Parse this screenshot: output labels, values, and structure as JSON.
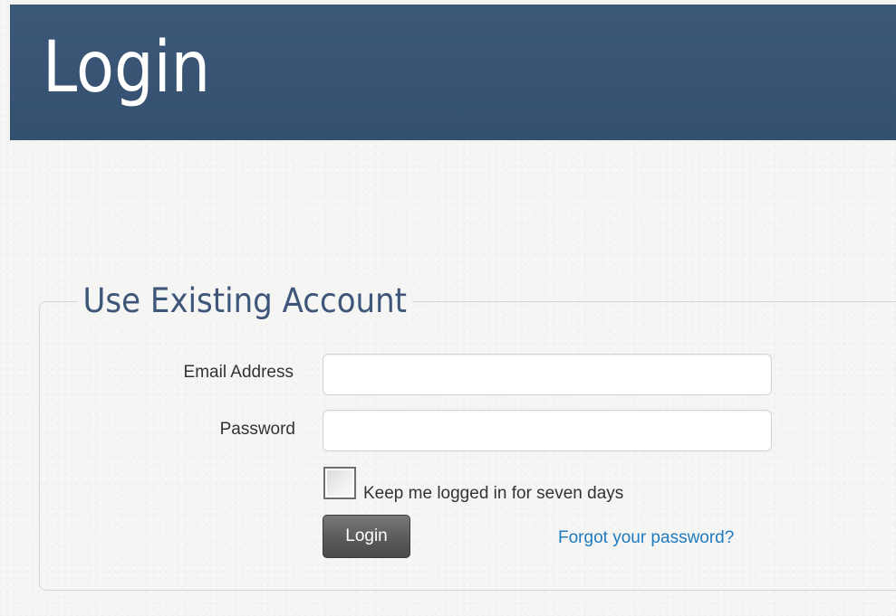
{
  "header": {
    "title": "Login"
  },
  "login_form": {
    "legend": "Use Existing Account",
    "email": {
      "label": "Email Address",
      "value": ""
    },
    "password": {
      "label": "Password",
      "value": ""
    },
    "remember": {
      "label": "Keep me logged in for seven days",
      "checked": false
    },
    "submit_label": "Login",
    "forgot_link": "Forgot your password?"
  },
  "colors": {
    "header_bg": "#395474",
    "legend_text": "#3e5679",
    "link": "#1f7bbf",
    "button_bg": "#5b5b5b"
  }
}
